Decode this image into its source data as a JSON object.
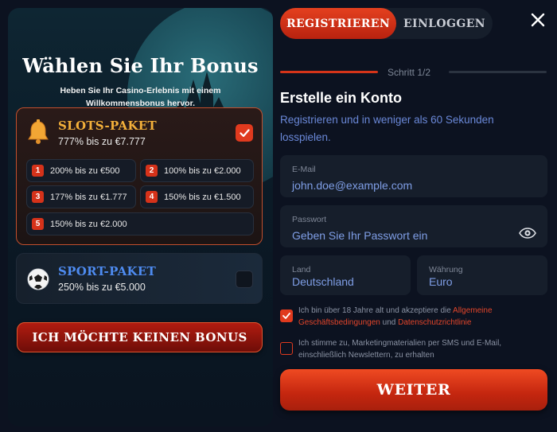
{
  "left": {
    "title": "Wählen Sie Ihr Bonus",
    "subtitle": "Heben Sie Ihr Casino-Erlebnis mit einem Willkommensbonus hervor.",
    "packages": [
      {
        "name": "SLOTS-PAKET",
        "description": "777% bis zu €7.777",
        "icon": "bell-icon",
        "selected": true,
        "bonuses": [
          {
            "num": "1",
            "text": "200% bis zu €500"
          },
          {
            "num": "2",
            "text": "100% bis zu €2.000"
          },
          {
            "num": "3",
            "text": "177% bis zu €1.777"
          },
          {
            "num": "4",
            "text": "150% bis zu €1.500"
          },
          {
            "num": "5",
            "text": "150% bis zu €2.000"
          }
        ]
      },
      {
        "name": "SPORT-PAKET",
        "description": "250% bis zu €5.000",
        "icon": "soccer-ball-icon",
        "selected": false
      }
    ],
    "no_bonus_label": "ICH MÖCHTE KEINEN BONUS"
  },
  "tabs": {
    "register": "REGISTRIEREN",
    "login": "EINLOGGEN",
    "active": "register"
  },
  "step": "Schritt 1/2",
  "form": {
    "title": "Erstelle ein Konto",
    "subtitle": "Registrieren und in weniger als 60 Sekunden losspielen.",
    "email": {
      "label": "E-Mail",
      "placeholder": "john.doe@example.com"
    },
    "password": {
      "label": "Passwort",
      "placeholder": "Geben Sie Ihr Passwort ein"
    },
    "country": {
      "label": "Land",
      "value": "Deutschland"
    },
    "currency": {
      "label": "Währung",
      "value": "Euro"
    },
    "terms": {
      "checked": true,
      "text_before": "Ich bin über 18 Jahre alt und akzeptiere die ",
      "link1": "Allgemeine Geschäftsbedingungen",
      "text_middle": " und ",
      "link2": "Datenschutzrichtlinie"
    },
    "marketing": {
      "checked": false,
      "text": "Ich stimme zu, Marketingmaterialien per SMS und E-Mail, einschließlich Newslettern, zu erhalten"
    },
    "submit_label": "WEITER"
  },
  "colors": {
    "accent": "#e03a1e",
    "gold": "#f3b03a",
    "sport_blue": "#4e8bf0",
    "link_blue": "#6a88d8"
  }
}
